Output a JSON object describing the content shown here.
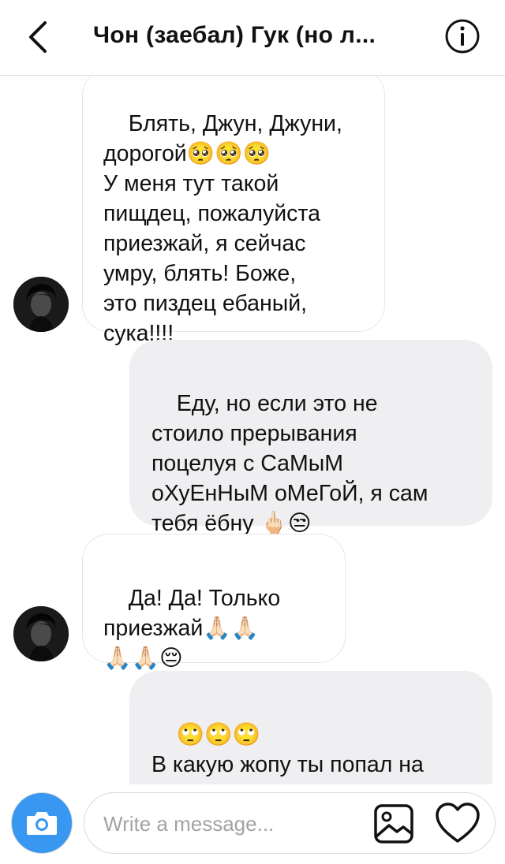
{
  "header": {
    "title": "Чон (заебал) Гук (но л...",
    "back_icon": "chevron-left-icon",
    "info_icon": "info-icon"
  },
  "messages": [
    {
      "direction": "incoming",
      "text": "Блять, Джун, Джуни,\nдорогой🥺🥺🥺\nУ меня тут такой\nпищдец, пожалуйста\nприезжай, я сейчас\nумру, блять! Боже,\nэто пиздец ебаный,\nсука!!!!"
    },
    {
      "direction": "outgoing",
      "text": "Еду, но если это не\nстоило прерывания\nпоцелуя с СаМыМ\nоХуЕнНыМ оМеГоЙ, я сам\nтебя ёбну 🖕🏻😒"
    },
    {
      "direction": "incoming",
      "text": "Да! Да! Только\nприезжай🙏🏻🙏🏻\n🙏🏻🙏🏻😔"
    },
    {
      "direction": "outgoing",
      "text": "🙄🙄🙄\nВ какую жопу ты попал на\nэтот раз)"
    }
  ],
  "composer": {
    "placeholder": "Write a message...",
    "value": "",
    "camera_icon": "camera-icon",
    "gallery_icon": "image-icon",
    "like_icon": "heart-icon",
    "accent_color": "#3897f0"
  },
  "colors": {
    "outgoing_bubble": "#efeff1",
    "incoming_border": "#e6e6e6"
  }
}
